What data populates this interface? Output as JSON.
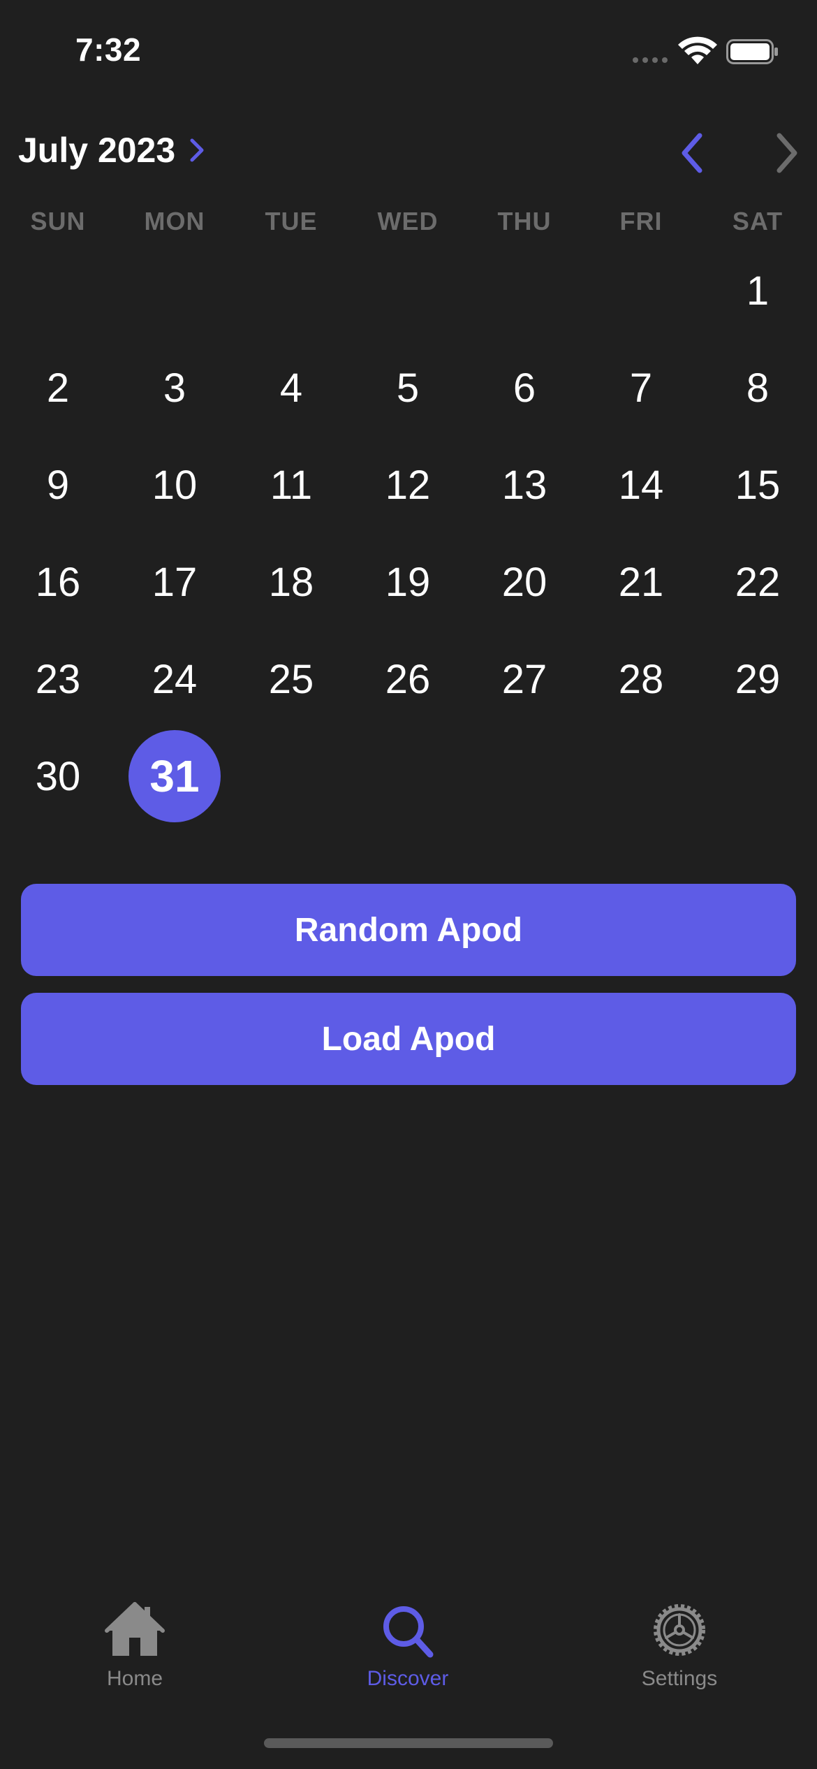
{
  "status_bar": {
    "time": "7:32"
  },
  "calendar": {
    "month_title": "July 2023",
    "weekdays": [
      "SUN",
      "MON",
      "TUE",
      "WED",
      "THU",
      "FRI",
      "SAT"
    ],
    "first_weekday_index": 6,
    "days_in_month": 31,
    "selected_day": 31,
    "accent_color": "#5e5ce6"
  },
  "buttons": {
    "random_label": "Random Apod",
    "load_label": "Load Apod"
  },
  "tabbar": {
    "items": [
      {
        "label": "Home",
        "icon": "house-icon",
        "active": false
      },
      {
        "label": "Discover",
        "icon": "magnifying-glass-icon",
        "active": true
      },
      {
        "label": "Settings",
        "icon": "gear-icon",
        "active": false
      }
    ]
  },
  "colors": {
    "background": "#1f1f1f",
    "accent": "#5e5ce6",
    "muted": "#8a8a8a"
  }
}
